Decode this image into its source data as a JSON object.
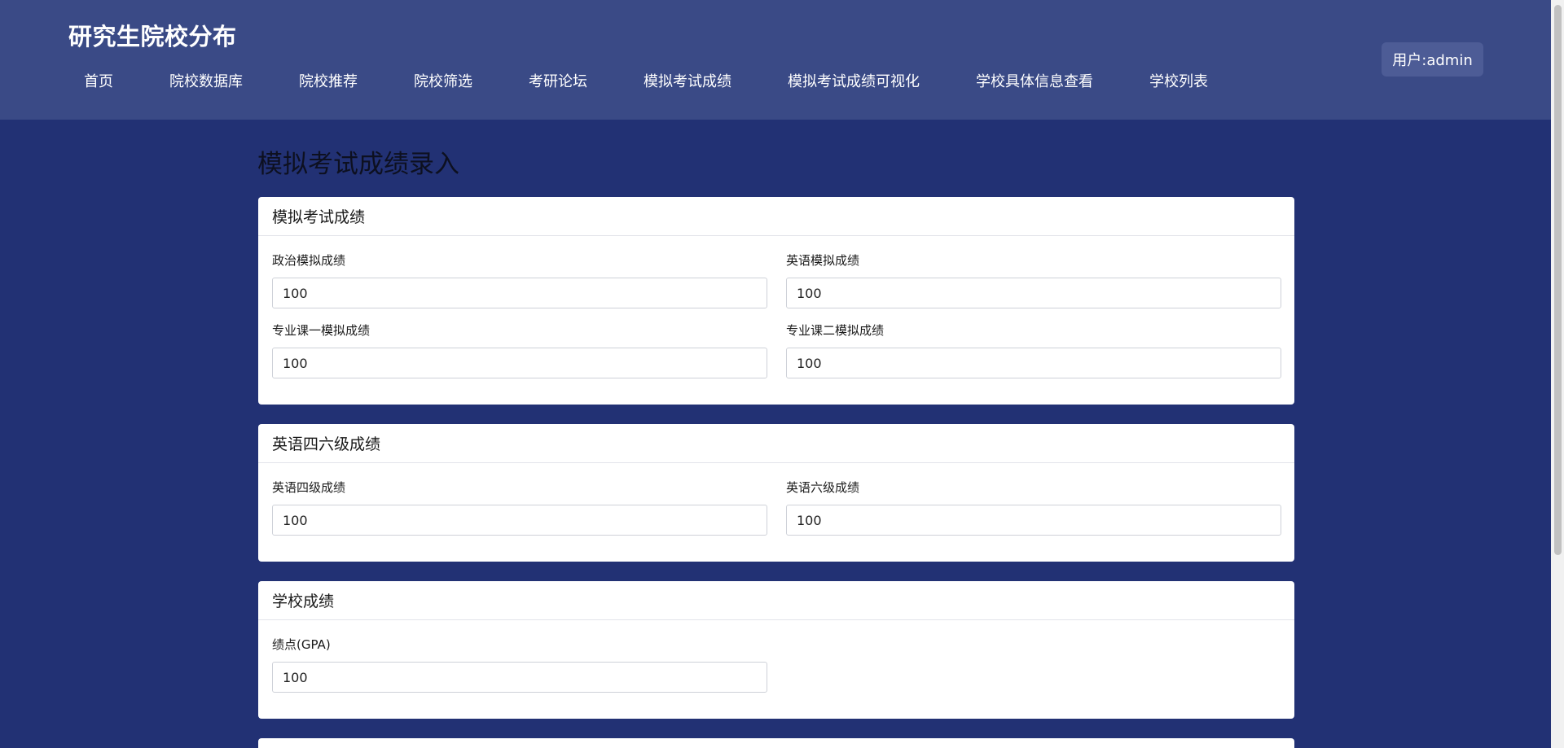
{
  "header": {
    "brand": "研究生院校分布",
    "nav": [
      "首页",
      "院校数据库",
      "院校推荐",
      "院校筛选",
      "考研论坛",
      "模拟考试成绩",
      "模拟考试成绩可视化",
      "学校具体信息查看",
      "学校列表"
    ],
    "user": "用户:admin"
  },
  "page": {
    "title": "模拟考试成绩录入"
  },
  "sections": {
    "mock": {
      "title": "模拟考试成绩",
      "politics_label": "政治模拟成绩",
      "politics_value": "100",
      "english_label": "英语模拟成绩",
      "english_value": "100",
      "major1_label": "专业课一模拟成绩",
      "major1_value": "100",
      "major2_label": "专业课二模拟成绩",
      "major2_value": "100"
    },
    "cet": {
      "title": "英语四六级成绩",
      "cet4_label": "英语四级成绩",
      "cet4_value": "100",
      "cet6_label": "英语六级成绩",
      "cet6_value": "100"
    },
    "school": {
      "title": "学校成绩",
      "gpa_label": "绩点(GPA)",
      "gpa_value": "100"
    }
  }
}
